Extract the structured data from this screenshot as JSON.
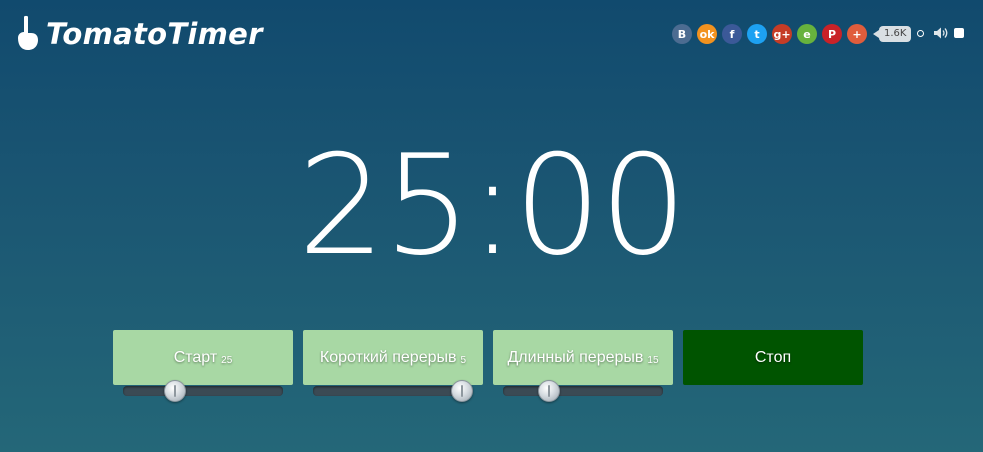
{
  "app": {
    "logo_text": "TomatoTimer",
    "logo_icon": "hand-pointer-icon"
  },
  "share": {
    "buttons": [
      {
        "name": "vk",
        "glyph": "B",
        "color": "#4c6c91"
      },
      {
        "name": "odnoklassniki",
        "glyph": "ok",
        "color": "#f2921f"
      },
      {
        "name": "facebook",
        "glyph": "f",
        "color": "#3b5998"
      },
      {
        "name": "twitter",
        "glyph": "t",
        "color": "#1da1f2"
      },
      {
        "name": "google-plus",
        "glyph": "g+",
        "color": "#c53c26"
      },
      {
        "name": "evernote",
        "glyph": "e",
        "color": "#67b23d"
      },
      {
        "name": "pinterest",
        "glyph": "P",
        "color": "#c92228"
      },
      {
        "name": "more",
        "glyph": "+",
        "color": "#e05d3c"
      }
    ],
    "count": "1.6K"
  },
  "timer": {
    "display": "25:00"
  },
  "modes": [
    {
      "label": "Старт",
      "minutes": "25",
      "slider_level": 0.3
    },
    {
      "label": "Короткий перерыв",
      "minutes": "5",
      "slider_level": 1.0
    },
    {
      "label": "Длинный перерыв",
      "minutes": "15",
      "slider_level": 0.25
    }
  ],
  "stop": {
    "label": "Стоп"
  },
  "colors": {
    "mode_button": "#a8d8a4",
    "stop_button": "#005400",
    "background_top": "#114a6e",
    "background_bottom": "#246778"
  }
}
